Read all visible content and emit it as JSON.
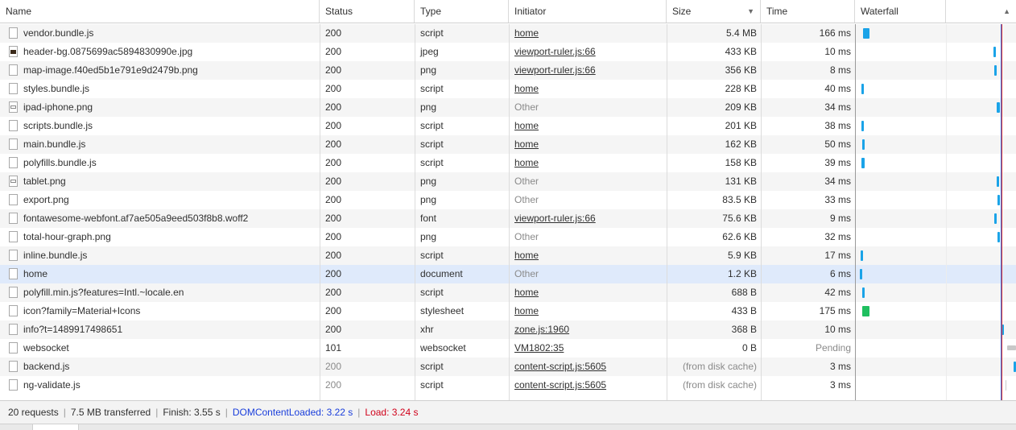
{
  "columns": {
    "name": "Name",
    "status": "Status",
    "type": "Type",
    "initiator": "Initiator",
    "size": "Size",
    "time": "Time",
    "waterfall": "Waterfall"
  },
  "requests": [
    {
      "name": "vendor.bundle.js",
      "status": "200",
      "type": "script",
      "initiator": "home",
      "size": "5.4 MB",
      "time": "166 ms",
      "icon": "file-icon"
    },
    {
      "name": "header-bg.0875699ac5894830990e.jpg",
      "status": "200",
      "type": "jpeg",
      "initiator": "viewport-ruler.js:66",
      "size": "433 KB",
      "time": "10 ms",
      "icon": "image-thumbnail-icon"
    },
    {
      "name": "map-image.f40ed5b1e791e9d2479b.png",
      "status": "200",
      "type": "png",
      "initiator": "viewport-ruler.js:66",
      "size": "356 KB",
      "time": "8 ms",
      "icon": "file-icon"
    },
    {
      "name": "styles.bundle.js",
      "status": "200",
      "type": "script",
      "initiator": "home",
      "size": "228 KB",
      "time": "40 ms",
      "icon": "file-icon"
    },
    {
      "name": "ipad-iphone.png",
      "status": "200",
      "type": "png",
      "initiator": "Other",
      "size": "209 KB",
      "time": "34 ms",
      "icon": "image-file-icon"
    },
    {
      "name": "scripts.bundle.js",
      "status": "200",
      "type": "script",
      "initiator": "home",
      "size": "201 KB",
      "time": "38 ms",
      "icon": "file-icon"
    },
    {
      "name": "main.bundle.js",
      "status": "200",
      "type": "script",
      "initiator": "home",
      "size": "162 KB",
      "time": "50 ms",
      "icon": "file-icon"
    },
    {
      "name": "polyfills.bundle.js",
      "status": "200",
      "type": "script",
      "initiator": "home",
      "size": "158 KB",
      "time": "39 ms",
      "icon": "file-icon"
    },
    {
      "name": "tablet.png",
      "status": "200",
      "type": "png",
      "initiator": "Other",
      "size": "131 KB",
      "time": "34 ms",
      "icon": "image-file-icon"
    },
    {
      "name": "export.png",
      "status": "200",
      "type": "png",
      "initiator": "Other",
      "size": "83.5 KB",
      "time": "33 ms",
      "icon": "file-icon"
    },
    {
      "name": "fontawesome-webfont.af7ae505a9eed503f8b8.woff2",
      "status": "200",
      "type": "font",
      "initiator": "viewport-ruler.js:66",
      "size": "75.6 KB",
      "time": "9 ms",
      "icon": "file-icon"
    },
    {
      "name": "total-hour-graph.png",
      "status": "200",
      "type": "png",
      "initiator": "Other",
      "size": "62.6 KB",
      "time": "32 ms",
      "icon": "file-icon"
    },
    {
      "name": "inline.bundle.js",
      "status": "200",
      "type": "script",
      "initiator": "home",
      "size": "5.9 KB",
      "time": "17 ms",
      "icon": "file-icon"
    },
    {
      "name": "home",
      "status": "200",
      "type": "document",
      "initiator": "Other",
      "size": "1.2 KB",
      "time": "6 ms",
      "icon": "file-icon"
    },
    {
      "name": "polyfill.min.js?features=Intl.~locale.en",
      "status": "200",
      "type": "script",
      "initiator": "home",
      "size": "688 B",
      "time": "42 ms",
      "icon": "file-icon"
    },
    {
      "name": "icon?family=Material+Icons",
      "status": "200",
      "type": "stylesheet",
      "initiator": "home",
      "size": "433 B",
      "time": "175 ms",
      "icon": "file-icon"
    },
    {
      "name": "info?t=1489917498651",
      "status": "200",
      "type": "xhr",
      "initiator": "zone.js:1960",
      "size": "368 B",
      "time": "10 ms",
      "icon": "file-icon"
    },
    {
      "name": "websocket",
      "status": "101",
      "type": "websocket",
      "initiator": "VM1802:35",
      "size": "0 B",
      "time": "Pending",
      "icon": "file-icon"
    },
    {
      "name": "backend.js",
      "status": "200",
      "type": "script",
      "initiator": "content-script.js:5605",
      "size": "(from disk cache)",
      "time": "3 ms",
      "icon": "file-icon"
    },
    {
      "name": "ng-validate.js",
      "status": "200",
      "type": "script",
      "initiator": "content-script.js:5605",
      "size": "(from disk cache)",
      "time": "3 ms",
      "icon": "file-icon"
    }
  ],
  "footer": {
    "requests": "20 requests",
    "transferred": "7.5 MB transferred",
    "finish": "Finish: 3.55 s",
    "dom_content_loaded": "DOMContentLoaded: 3.22 s",
    "load": "Load: 3.24 s"
  },
  "colors": {
    "script_bar": "#1aa3e8",
    "stylesheet_bar": "#1fbf5f",
    "pending_bar": "#c8c8c8",
    "dom_line": "#3b6fe3",
    "load_line": "#e2342f",
    "selected_row": "#dfeafb"
  }
}
